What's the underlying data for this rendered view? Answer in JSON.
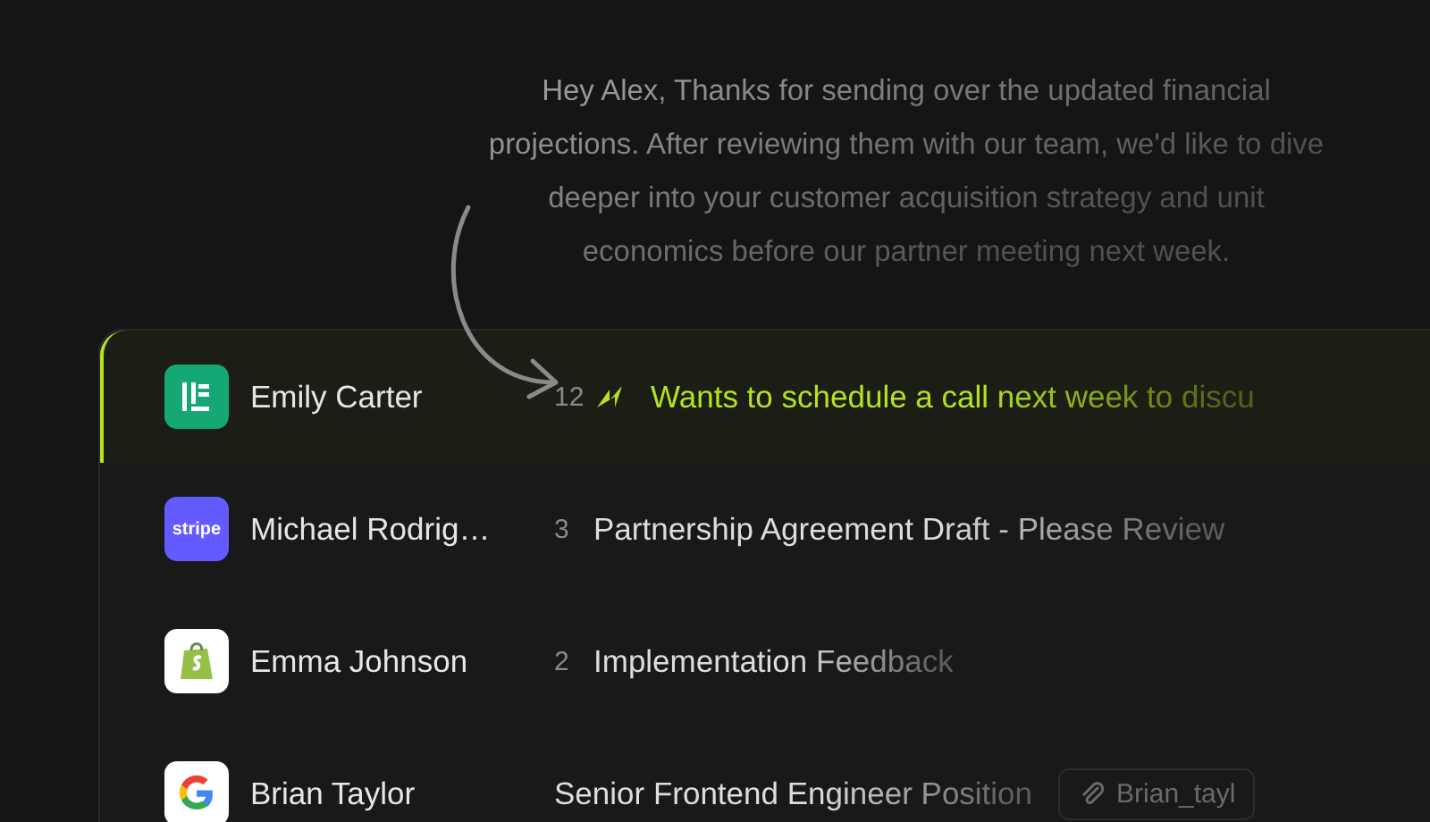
{
  "preview": {
    "text": "Hey Alex, Thanks for sending over the updated financial projections. After reviewing them with our team, we'd like to dive deeper into your customer acquisition strategy and unit economics before our partner meeting next week."
  },
  "rows": [
    {
      "sender": "Emily Carter",
      "kind": "emily",
      "count": "12",
      "priority": true,
      "subject": "Wants to schedule a call next week to discu",
      "selected": true
    },
    {
      "sender": "Michael Rodrig…",
      "kind": "stripe",
      "logo_text": "stripe",
      "count": "3",
      "priority": false,
      "subject": "Partnership Agreement Draft - Please Review",
      "selected": false
    },
    {
      "sender": "Emma Johnson",
      "kind": "shopify",
      "count": "2",
      "priority": false,
      "subject": "Implementation Feedback",
      "selected": false
    },
    {
      "sender": "Brian Taylor",
      "kind": "google",
      "priority": false,
      "subject": "Senior Frontend Engineer Position",
      "attachment": "Brian_tayl",
      "selected": false
    }
  ]
}
